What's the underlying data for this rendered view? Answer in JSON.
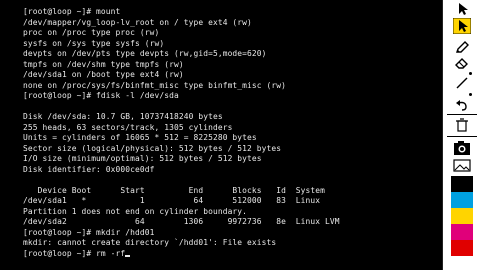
{
  "terminal": {
    "lines": [
      "[root@loop ~]# mount",
      "/dev/mapper/vg_loop-lv_root on / type ext4 (rw)",
      "proc on /proc type proc (rw)",
      "sysfs on /sys type sysfs (rw)",
      "devpts on /dev/pts type devpts (rw,gid=5,mode=620)",
      "tmpfs on /dev/shm type tmpfs (rw)",
      "/dev/sda1 on /boot type ext4 (rw)",
      "none on /proc/sys/fs/binfmt_misc type binfmt_misc (rw)",
      "[root@loop ~]# fdisk -l /dev/sda",
      "",
      "Disk /dev/sda: 10.7 GB, 10737418240 bytes",
      "255 heads, 63 sectors/track, 1305 cylinders",
      "Units = cylinders of 16065 * 512 = 8225280 bytes",
      "Sector size (logical/physical): 512 bytes / 512 bytes",
      "I/O size (minimum/optimal): 512 bytes / 512 bytes",
      "Disk identifier: 0x000ce0df",
      "",
      "   Device Boot      Start         End      Blocks   Id  System",
      "/dev/sda1   *           1          64      512000   83  Linux",
      "Partition 1 does not end on cylinder boundary.",
      "/dev/sda2              64        1306     9972736   8e  Linux LVM",
      "[root@loop ~]# mkdir /hdd01",
      "mkdir: cannot create directory `/hdd01': File exists",
      "[root@loop ~]# rm -rf"
    ]
  },
  "toolbar": {
    "tools": [
      "cursor-icon",
      "highlight-arrow-icon",
      "pen-icon",
      "eraser-icon",
      "line-icon",
      "undo-icon",
      "trash-icon",
      "camera-icon",
      "image-icon"
    ],
    "colors": [
      "#000000",
      "#00a0e0",
      "#ffd400",
      "#e0007a",
      "#e00000"
    ]
  }
}
